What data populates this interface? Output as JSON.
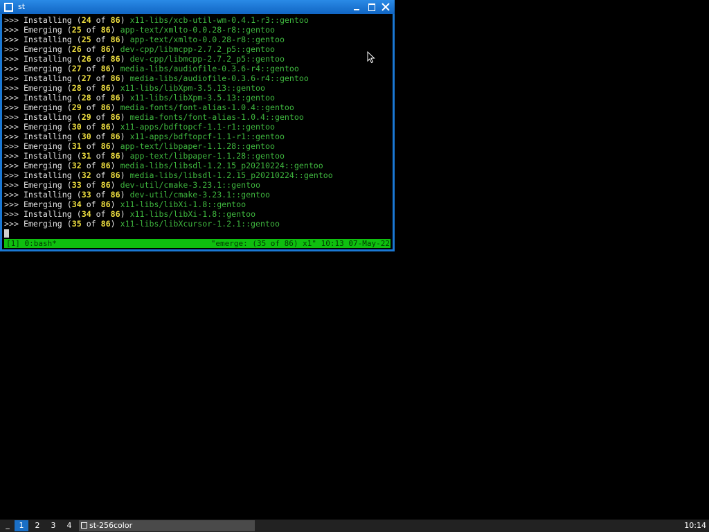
{
  "window": {
    "title": "st",
    "controls": {
      "minimize": "minimize",
      "maximize": "maximize",
      "close": "close"
    }
  },
  "terminal": {
    "lines": [
      {
        "prompt": ">>>",
        "verb": "Installing",
        "current": "24",
        "of": "of",
        "total": "86",
        "package": "x11-libs/xcb-util-wm-0.4.1-r3::gentoo"
      },
      {
        "prompt": ">>>",
        "verb": "Emerging",
        "current": "25",
        "of": "of",
        "total": "86",
        "package": "app-text/xmlto-0.0.28-r8::gentoo"
      },
      {
        "prompt": ">>>",
        "verb": "Installing",
        "current": "25",
        "of": "of",
        "total": "86",
        "package": "app-text/xmlto-0.0.28-r8::gentoo"
      },
      {
        "prompt": ">>>",
        "verb": "Emerging",
        "current": "26",
        "of": "of",
        "total": "86",
        "package": "dev-cpp/libmcpp-2.7.2_p5::gentoo"
      },
      {
        "prompt": ">>>",
        "verb": "Installing",
        "current": "26",
        "of": "of",
        "total": "86",
        "package": "dev-cpp/libmcpp-2.7.2_p5::gentoo"
      },
      {
        "prompt": ">>>",
        "verb": "Emerging",
        "current": "27",
        "of": "of",
        "total": "86",
        "package": "media-libs/audiofile-0.3.6-r4::gentoo"
      },
      {
        "prompt": ">>>",
        "verb": "Installing",
        "current": "27",
        "of": "of",
        "total": "86",
        "package": "media-libs/audiofile-0.3.6-r4::gentoo"
      },
      {
        "prompt": ">>>",
        "verb": "Emerging",
        "current": "28",
        "of": "of",
        "total": "86",
        "package": "x11-libs/libXpm-3.5.13::gentoo"
      },
      {
        "prompt": ">>>",
        "verb": "Installing",
        "current": "28",
        "of": "of",
        "total": "86",
        "package": "x11-libs/libXpm-3.5.13::gentoo"
      },
      {
        "prompt": ">>>",
        "verb": "Emerging",
        "current": "29",
        "of": "of",
        "total": "86",
        "package": "media-fonts/font-alias-1.0.4::gentoo"
      },
      {
        "prompt": ">>>",
        "verb": "Installing",
        "current": "29",
        "of": "of",
        "total": "86",
        "package": "media-fonts/font-alias-1.0.4::gentoo"
      },
      {
        "prompt": ">>>",
        "verb": "Emerging",
        "current": "30",
        "of": "of",
        "total": "86",
        "package": "x11-apps/bdftopcf-1.1-r1::gentoo"
      },
      {
        "prompt": ">>>",
        "verb": "Installing",
        "current": "30",
        "of": "of",
        "total": "86",
        "package": "x11-apps/bdftopcf-1.1-r1::gentoo"
      },
      {
        "prompt": ">>>",
        "verb": "Emerging",
        "current": "31",
        "of": "of",
        "total": "86",
        "package": "app-text/libpaper-1.1.28::gentoo"
      },
      {
        "prompt": ">>>",
        "verb": "Installing",
        "current": "31",
        "of": "of",
        "total": "86",
        "package": "app-text/libpaper-1.1.28::gentoo"
      },
      {
        "prompt": ">>>",
        "verb": "Emerging",
        "current": "32",
        "of": "of",
        "total": "86",
        "package": "media-libs/libsdl-1.2.15_p20210224::gentoo"
      },
      {
        "prompt": ">>>",
        "verb": "Installing",
        "current": "32",
        "of": "of",
        "total": "86",
        "package": "media-libs/libsdl-1.2.15_p20210224::gentoo"
      },
      {
        "prompt": ">>>",
        "verb": "Emerging",
        "current": "33",
        "of": "of",
        "total": "86",
        "package": "dev-util/cmake-3.23.1::gentoo"
      },
      {
        "prompt": ">>>",
        "verb": "Installing",
        "current": "33",
        "of": "of",
        "total": "86",
        "package": "dev-util/cmake-3.23.1::gentoo"
      },
      {
        "prompt": ">>>",
        "verb": "Emerging",
        "current": "34",
        "of": "of",
        "total": "86",
        "package": "x11-libs/libXi-1.8::gentoo"
      },
      {
        "prompt": ">>>",
        "verb": "Installing",
        "current": "34",
        "of": "of",
        "total": "86",
        "package": "x11-libs/libXi-1.8::gentoo"
      },
      {
        "prompt": ">>>",
        "verb": "Emerging",
        "current": "35",
        "of": "of",
        "total": "86",
        "package": "x11-libs/libXcursor-1.2.1::gentoo"
      }
    ],
    "status_left": "[1] 0:bash*",
    "status_right": "\"emerge: (35 of 86) x1\" 10:13 07-May-22"
  },
  "taskbar": {
    "menu_label": "_",
    "workspaces": [
      "1",
      "2",
      "3",
      "4"
    ],
    "active_workspace": "1",
    "task_label": "st-256color",
    "clock": "10:14"
  },
  "colors": {
    "title_bar": "#1a78d4",
    "status_bar": "#0fbf0f",
    "package_text": "#3fb83f",
    "number_text": "#f0e040",
    "active_workspace": "#1a6fc6"
  }
}
